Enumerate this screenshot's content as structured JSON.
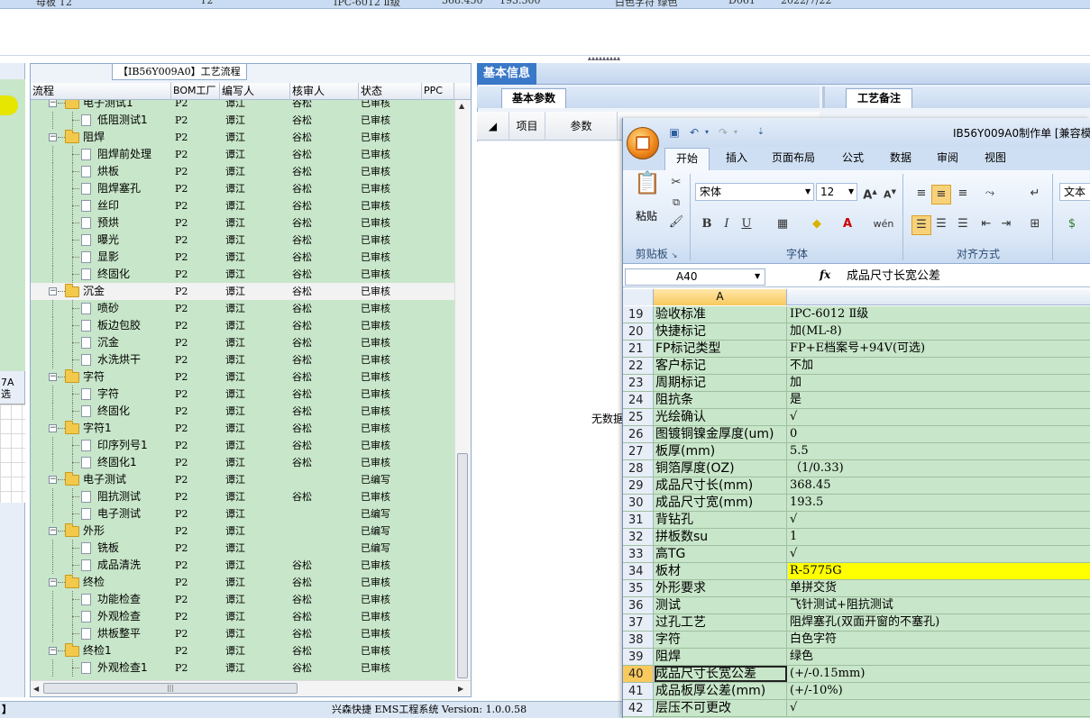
{
  "top_strip": {
    "cells": [
      "母板  T2",
      "T2",
      "IPC-6012 Ⅱ级",
      "368.450",
      "193.500",
      "白色字符  绿色",
      "D061",
      "2022/7/22"
    ]
  },
  "splitter_grip": "▴▴▴▴▴▴▴▴▴",
  "left_strip": {
    "label_line1": "7A",
    "label_line2": "选"
  },
  "process_panel": {
    "tab_title": "【IB56Y009A0】工艺流程",
    "columns": [
      "流程",
      "BOM工厂",
      "编写人",
      "核审人",
      "状态",
      "PPC"
    ],
    "rows": [
      {
        "name": "电子测试1",
        "level": 0,
        "factory": "P2",
        "writer": "谭江",
        "reviewer": "谷松",
        "status": "已审核"
      },
      {
        "name": "低阻测试1",
        "level": 1,
        "factory": "P2",
        "writer": "谭江",
        "reviewer": "谷松",
        "status": "已审核"
      },
      {
        "name": "阻焊",
        "level": 0,
        "factory": "P2",
        "writer": "谭江",
        "reviewer": "谷松",
        "status": "已审核"
      },
      {
        "name": "阻焊前处理",
        "level": 1,
        "factory": "P2",
        "writer": "谭江",
        "reviewer": "谷松",
        "status": "已审核"
      },
      {
        "name": "烘板",
        "level": 1,
        "factory": "P2",
        "writer": "谭江",
        "reviewer": "谷松",
        "status": "已审核"
      },
      {
        "name": "阻焊塞孔",
        "level": 1,
        "factory": "P2",
        "writer": "谭江",
        "reviewer": "谷松",
        "status": "已审核"
      },
      {
        "name": "丝印",
        "level": 1,
        "factory": "P2",
        "writer": "谭江",
        "reviewer": "谷松",
        "status": "已审核"
      },
      {
        "name": "预烘",
        "level": 1,
        "factory": "P2",
        "writer": "谭江",
        "reviewer": "谷松",
        "status": "已审核"
      },
      {
        "name": "曝光",
        "level": 1,
        "factory": "P2",
        "writer": "谭江",
        "reviewer": "谷松",
        "status": "已审核"
      },
      {
        "name": "显影",
        "level": 1,
        "factory": "P2",
        "writer": "谭江",
        "reviewer": "谷松",
        "status": "已审核"
      },
      {
        "name": "终固化",
        "level": 1,
        "factory": "P2",
        "writer": "谭江",
        "reviewer": "谷松",
        "status": "已审核"
      },
      {
        "name": "沉金",
        "level": 0,
        "factory": "P2",
        "writer": "谭江",
        "reviewer": "谷松",
        "status": "已审核",
        "selected": true
      },
      {
        "name": "喷砂",
        "level": 1,
        "factory": "P2",
        "writer": "谭江",
        "reviewer": "谷松",
        "status": "已审核"
      },
      {
        "name": "板边包胶",
        "level": 1,
        "factory": "P2",
        "writer": "谭江",
        "reviewer": "谷松",
        "status": "已审核"
      },
      {
        "name": "沉金",
        "level": 1,
        "factory": "P2",
        "writer": "谭江",
        "reviewer": "谷松",
        "status": "已审核"
      },
      {
        "name": "水洗烘干",
        "level": 1,
        "factory": "P2",
        "writer": "谭江",
        "reviewer": "谷松",
        "status": "已审核"
      },
      {
        "name": "字符",
        "level": 0,
        "factory": "P2",
        "writer": "谭江",
        "reviewer": "谷松",
        "status": "已审核"
      },
      {
        "name": "字符",
        "level": 1,
        "factory": "P2",
        "writer": "谭江",
        "reviewer": "谷松",
        "status": "已审核"
      },
      {
        "name": "终固化",
        "level": 1,
        "factory": "P2",
        "writer": "谭江",
        "reviewer": "谷松",
        "status": "已审核"
      },
      {
        "name": "字符1",
        "level": 0,
        "factory": "P2",
        "writer": "谭江",
        "reviewer": "谷松",
        "status": "已审核"
      },
      {
        "name": "印序列号1",
        "level": 1,
        "factory": "P2",
        "writer": "谭江",
        "reviewer": "谷松",
        "status": "已审核"
      },
      {
        "name": "终固化1",
        "level": 1,
        "factory": "P2",
        "writer": "谭江",
        "reviewer": "谷松",
        "status": "已审核"
      },
      {
        "name": "电子测试",
        "level": 0,
        "factory": "P2",
        "writer": "谭江",
        "reviewer": "",
        "status": "已编写"
      },
      {
        "name": "阻抗测试",
        "level": 1,
        "factory": "P2",
        "writer": "谭江",
        "reviewer": "谷松",
        "status": "已审核"
      },
      {
        "name": "电子测试",
        "level": 1,
        "factory": "P2",
        "writer": "谭江",
        "reviewer": "",
        "status": "已编写"
      },
      {
        "name": "外形",
        "level": 0,
        "factory": "P2",
        "writer": "谭江",
        "reviewer": "",
        "status": "已编写"
      },
      {
        "name": "铣板",
        "level": 1,
        "factory": "P2",
        "writer": "谭江",
        "reviewer": "",
        "status": "已编写"
      },
      {
        "name": "成品清洗",
        "level": 1,
        "factory": "P2",
        "writer": "谭江",
        "reviewer": "谷松",
        "status": "已审核"
      },
      {
        "name": "终检",
        "level": 0,
        "factory": "P2",
        "writer": "谭江",
        "reviewer": "谷松",
        "status": "已审核"
      },
      {
        "name": "功能检查",
        "level": 1,
        "factory": "P2",
        "writer": "谭江",
        "reviewer": "谷松",
        "status": "已审核"
      },
      {
        "name": "外观检查",
        "level": 1,
        "factory": "P2",
        "writer": "谭江",
        "reviewer": "谷松",
        "status": "已审核"
      },
      {
        "name": "烘板整平",
        "level": 1,
        "factory": "P2",
        "writer": "谭江",
        "reviewer": "谷松",
        "status": "已审核"
      },
      {
        "name": "终检1",
        "level": 0,
        "factory": "P2",
        "writer": "谭江",
        "reviewer": "谷松",
        "status": "已审核"
      },
      {
        "name": "外观检查1",
        "level": 1,
        "factory": "P2",
        "writer": "谭江",
        "reviewer": "谷松",
        "status": "已审核"
      }
    ]
  },
  "status_bar": {
    "text": "兴森快捷 EMS工程系统 Version: 1.0.0.58"
  },
  "right_panel": {
    "tab_basic": "基本信息",
    "tab_params": "基本参数",
    "tab_notes": "工艺备注",
    "col_item": "项目",
    "col_param": "参数",
    "no_data": "无数据"
  },
  "excel": {
    "title": "IB56Y009A0制作单 [兼容模",
    "tabs": [
      "开始",
      "插入",
      "页面布局",
      "公式",
      "数据",
      "审阅",
      "视图"
    ],
    "paste_label": "粘贴",
    "font_name": "宋体",
    "font_size": "12",
    "number_format": "文本",
    "groups": [
      "剪贴板",
      "字体",
      "对齐方式"
    ],
    "name_box": "A40",
    "fx_label": "fx",
    "formula_value": "成品尺寸长宽公差",
    "column_header": "A",
    "active_row": 40,
    "rows": [
      {
        "n": "19",
        "a": "验收标准",
        "b": "IPC-6012 Ⅱ级"
      },
      {
        "n": "20",
        "a": "快捷标记",
        "b": "加(ML-8)"
      },
      {
        "n": "21",
        "a": "FP标记类型",
        "b": "FP+E档案号+94V(可选)"
      },
      {
        "n": "22",
        "a": "客户标记",
        "b": "不加"
      },
      {
        "n": "23",
        "a": "周期标记",
        "b": "加"
      },
      {
        "n": "24",
        "a": "阻抗条",
        "b": "是"
      },
      {
        "n": "25",
        "a": "光绘确认",
        "b": "√"
      },
      {
        "n": "26",
        "a": "图镀铜镍金厚度(um)",
        "b": "0"
      },
      {
        "n": "27",
        "a": "板厚(mm)",
        "b": "5.5"
      },
      {
        "n": "28",
        "a": "铜箔厚度(OZ)",
        "b": "（1/0.33)"
      },
      {
        "n": "29",
        "a": "成品尺寸长(mm)",
        "b": "368.45"
      },
      {
        "n": "30",
        "a": "成品尺寸宽(mm)",
        "b": "193.5"
      },
      {
        "n": "31",
        "a": "背钻孔",
        "b": "√"
      },
      {
        "n": "32",
        "a": "拼板数su",
        "b": "1"
      },
      {
        "n": "33",
        "a": "高TG",
        "b": "√"
      },
      {
        "n": "34",
        "a": "板材",
        "b": "R-5775G",
        "highlight": true
      },
      {
        "n": "35",
        "a": "外形要求",
        "b": "单拼交货"
      },
      {
        "n": "36",
        "a": "测试",
        "b": "飞针测试+阻抗测试"
      },
      {
        "n": "37",
        "a": "过孔工艺",
        "b": "阻焊塞孔(双面开窗的不塞孔)"
      },
      {
        "n": "38",
        "a": "字符",
        "b": "白色字符"
      },
      {
        "n": "39",
        "a": "阻焊",
        "b": "绿色"
      },
      {
        "n": "40",
        "a": "成品尺寸长宽公差",
        "b": "(+/-0.15mm)"
      },
      {
        "n": "41",
        "a": "成品板厚公差(mm)",
        "b": "(+/-10%)"
      },
      {
        "n": "42",
        "a": "层压不可更改",
        "b": "√"
      }
    ]
  }
}
